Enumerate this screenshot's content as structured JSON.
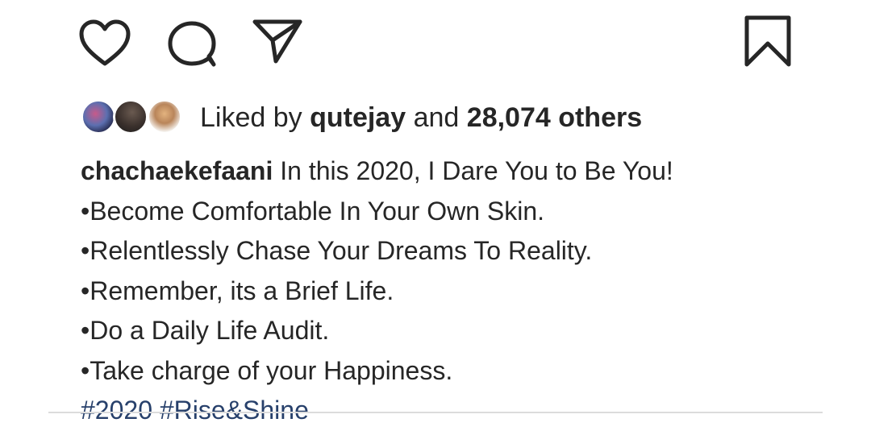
{
  "actions": {
    "like_icon": "heart-outline-icon",
    "comment_icon": "comment-bubble-icon",
    "share_icon": "paper-plane-icon",
    "save_icon": "bookmark-outline-icon",
    "icon_color": "#262626"
  },
  "likes": {
    "prefix": "Liked by",
    "user": "qutejay",
    "conjunction": "and",
    "count": "28,074 others",
    "avatars": [
      "avatar-1",
      "avatar-2",
      "avatar-3"
    ]
  },
  "caption": {
    "username": "chachaekefaani",
    "first_line": " In this 2020,  I Dare You to Be You!",
    "lines": [
      "•Become Comfortable In Your Own Skin.",
      "•Relentlessly Chase Your Dreams To Reality.",
      "•Remember, its a Brief Life.",
      "•Do a Daily Life Audit.",
      "•Take charge of your Happiness."
    ],
    "hashtags": [
      "#2020",
      "#Rise&Shine"
    ],
    "hashtag_color": "#27406b"
  }
}
